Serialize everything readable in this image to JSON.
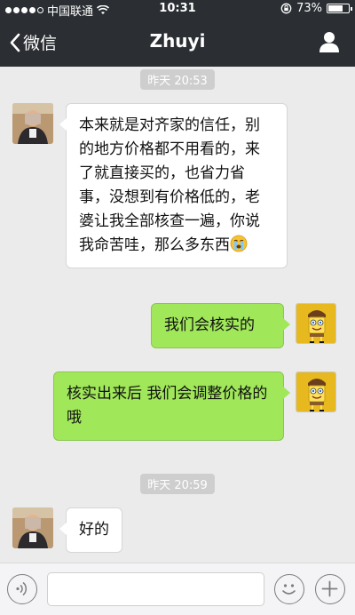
{
  "status_bar": {
    "carrier": "中国联通",
    "time": "10:31",
    "battery_percent": "73%",
    "battery_level": 0.73
  },
  "nav": {
    "back_label": "微信",
    "title": "Zhuyi"
  },
  "messages": [
    {
      "type": "timestamp",
      "text": "昨天 20:53"
    },
    {
      "type": "incoming",
      "text": "本来就是对齐家的信任，别的地方价格都不用看的，来了就直接买的，也省力省事，没想到有价格低的，老婆让我全部核查一遍，你说我命苦哇，那么多东西",
      "emoji": "crying-face"
    },
    {
      "type": "outgoing",
      "text": "我们会核实的"
    },
    {
      "type": "outgoing",
      "text": "核实出来后  我们会调整价格的哦"
    },
    {
      "type": "timestamp",
      "text": "昨天 20:59"
    },
    {
      "type": "incoming",
      "text": "好的"
    }
  ],
  "input_bar": {
    "placeholder": "",
    "icons": [
      "voice-icon",
      "emoji-icon",
      "plus-icon"
    ]
  },
  "colors": {
    "header_bg": "#2b2f33",
    "chat_bg": "#ebebeb",
    "outgoing_bubble": "#a0e75a",
    "incoming_bubble": "#ffffff"
  }
}
